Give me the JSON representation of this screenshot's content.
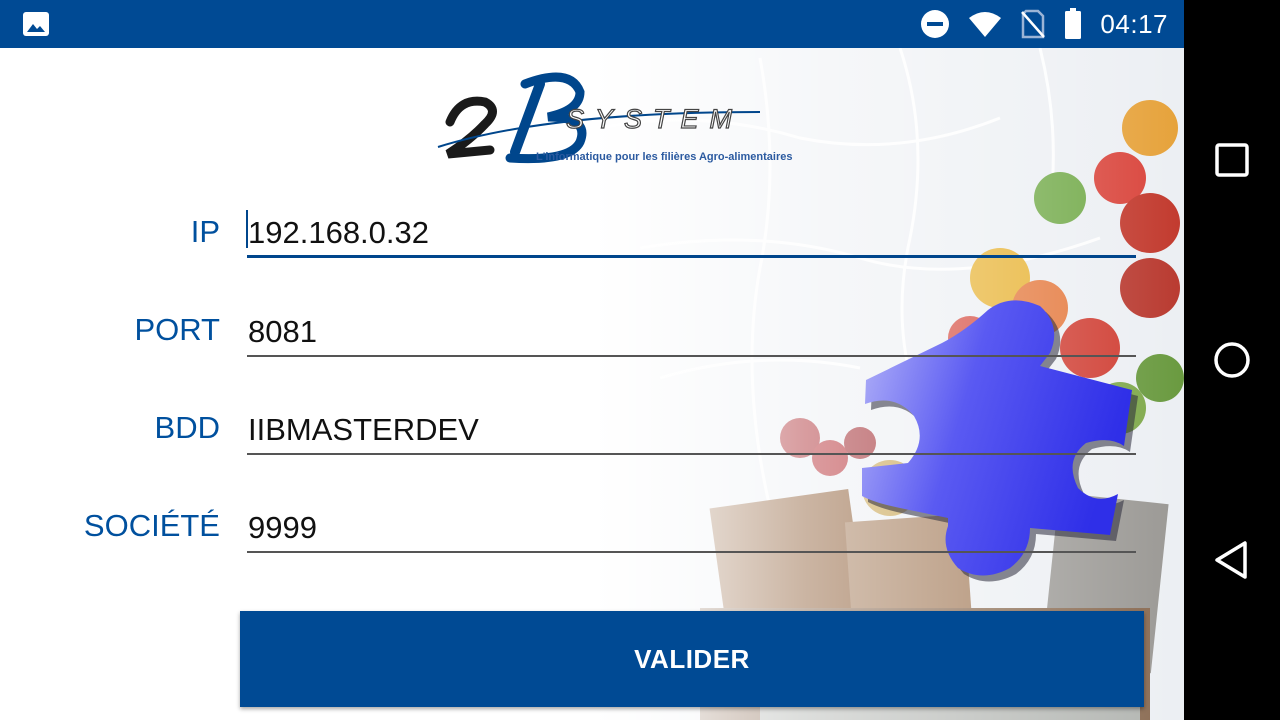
{
  "status_bar": {
    "time": "04:17",
    "icons": [
      "gallery-icon",
      "do-not-disturb-icon",
      "wifi-icon",
      "no-sim-icon",
      "battery-icon"
    ]
  },
  "logo": {
    "mark": "2B",
    "word": "SYSTEM",
    "tagline": "L'informatique pour les filières Agro-alimentaires"
  },
  "form": {
    "ip": {
      "label": "IP",
      "value": "192.168.0.32"
    },
    "port": {
      "label": "PORT",
      "value": "8081"
    },
    "bdd": {
      "label": "BDD",
      "value": "IIBMASTERDEV"
    },
    "societe": {
      "label": "SOCIÉTÉ",
      "value": "9999"
    }
  },
  "submit_label": "VALIDER",
  "nav": [
    "recents-icon",
    "home-icon",
    "back-icon"
  ],
  "colors": {
    "brand": "#004a94",
    "label": "#00509e",
    "puzzle": "#3a3ff0"
  }
}
